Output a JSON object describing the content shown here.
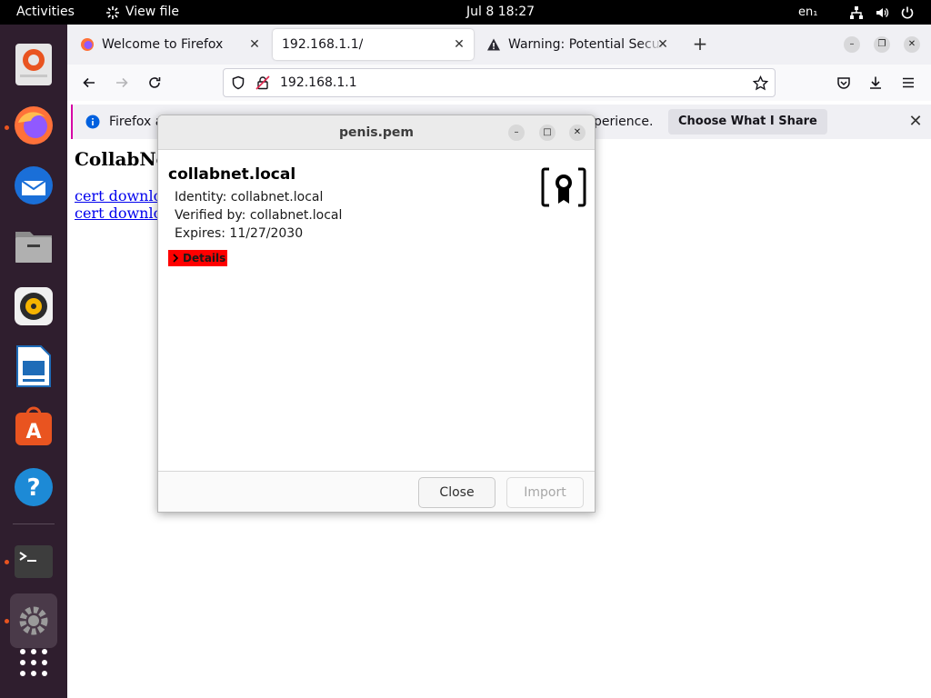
{
  "topbar": {
    "activities": "Activities",
    "app_name": "View file",
    "clock": "Jul 8  18:27",
    "lang": "en₁"
  },
  "dock": {
    "items": [
      "ubuntu-software-app",
      "firefox",
      "thunderbird",
      "files",
      "rhythmbox",
      "libreoffice-writer",
      "app-center",
      "help",
      "terminal",
      "settings",
      "show-apps"
    ],
    "accent": "#e95420"
  },
  "browser": {
    "tabs": [
      {
        "label": "Welcome to Firefox",
        "active": false
      },
      {
        "label": "192.168.1.1/",
        "active": true
      },
      {
        "label": "Warning: Potential Securi",
        "active": false
      }
    ],
    "url": "192.168.1.1",
    "notification": {
      "text_start": "Firefox a",
      "text_end": "perience.",
      "button": "Choose What I Share"
    },
    "page": {
      "heading": "CollabNe",
      "links": [
        "cert downlo",
        "cert downlo"
      ]
    }
  },
  "dialog": {
    "title": "penis.pem",
    "cert_name": "collabnet.local",
    "identity": "Identity: collabnet.local",
    "verified_by": "Verified by: collabnet.local",
    "expires": "Expires: 11/27/2030",
    "details_label": "Details",
    "close_button": "Close",
    "import_button": "Import",
    "highlight_color": "#ff0000"
  }
}
